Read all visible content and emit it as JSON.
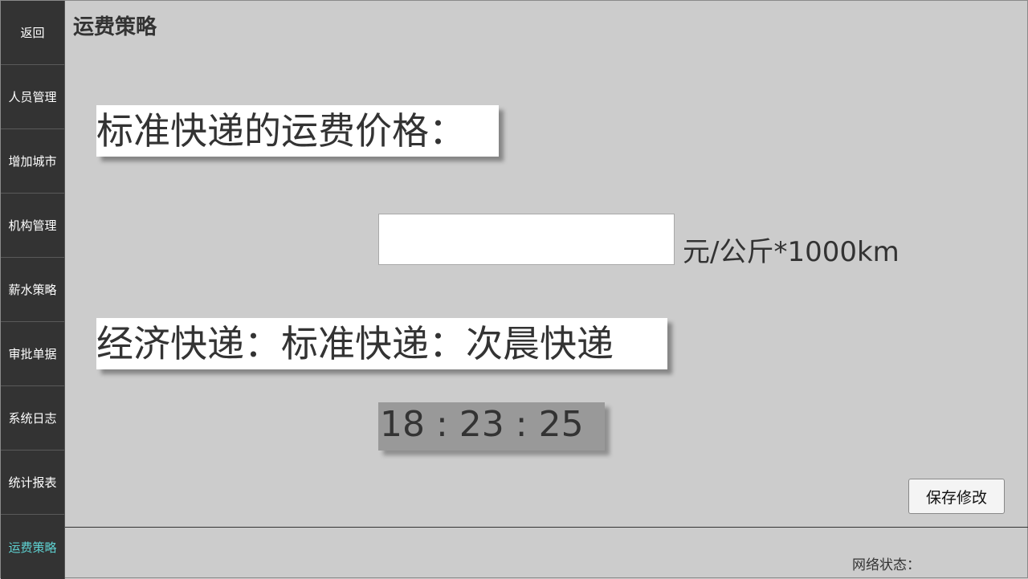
{
  "sidebar": {
    "items": [
      {
        "label": "返回"
      },
      {
        "label": "人员管理"
      },
      {
        "label": "增加城市"
      },
      {
        "label": "机构管理"
      },
      {
        "label": "薪水策略"
      },
      {
        "label": "审批单据"
      },
      {
        "label": "系统日志"
      },
      {
        "label": "统计报表"
      },
      {
        "label": "运费策略"
      }
    ],
    "active_color": "#5fd3d3"
  },
  "header": {
    "title": "运费策略"
  },
  "main": {
    "standard_label": "标准快递的运费价格：",
    "price_input": {
      "value": "",
      "placeholder": ""
    },
    "unit": "元/公斤*1000km",
    "ratio_label": "经济快递：标准快递：次晨快递",
    "ratio_value": "18 : 23 : 25",
    "save_label": "保存修改"
  },
  "footer": {
    "network_status_label": "网络状态："
  }
}
